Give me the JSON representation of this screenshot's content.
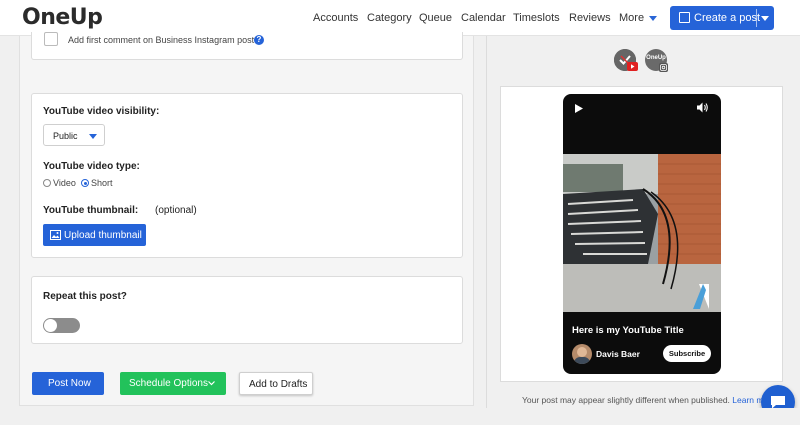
{
  "header": {
    "logo": "OneUp",
    "nav": [
      "Accounts",
      "Category",
      "Queue",
      "Calendar",
      "Timeslots",
      "Reviews",
      "More"
    ],
    "create_post": "Create a post"
  },
  "left": {
    "instagram_comment_label": "Add first comment on Business Instagram post?",
    "youtube": {
      "visibility_label": "YouTube video visibility:",
      "visibility_value": "Public",
      "type_label": "YouTube video type:",
      "type_options": [
        "Video",
        "Short"
      ],
      "type_selected": "Short",
      "thumbnail_label": "YouTube thumbnail:",
      "thumbnail_optional": "(optional)",
      "upload_button": "Upload thumbnail"
    },
    "repeat": {
      "label": "Repeat this post?",
      "enabled": false
    },
    "actions": {
      "post_now": "Post Now",
      "schedule": "Schedule Options",
      "drafts": "Add to Drafts"
    }
  },
  "right": {
    "account_badge_text": "OneUp",
    "video_title": "Here is my YouTube Title",
    "channel_name": "Davis Baer",
    "subscribe": "Subscribe",
    "note": "Your post may appear slightly different when published.",
    "learn_more": "Learn more"
  },
  "colors": {
    "primary": "#2563d8",
    "green": "#22c25b",
    "youtube_red": "#e02020"
  }
}
